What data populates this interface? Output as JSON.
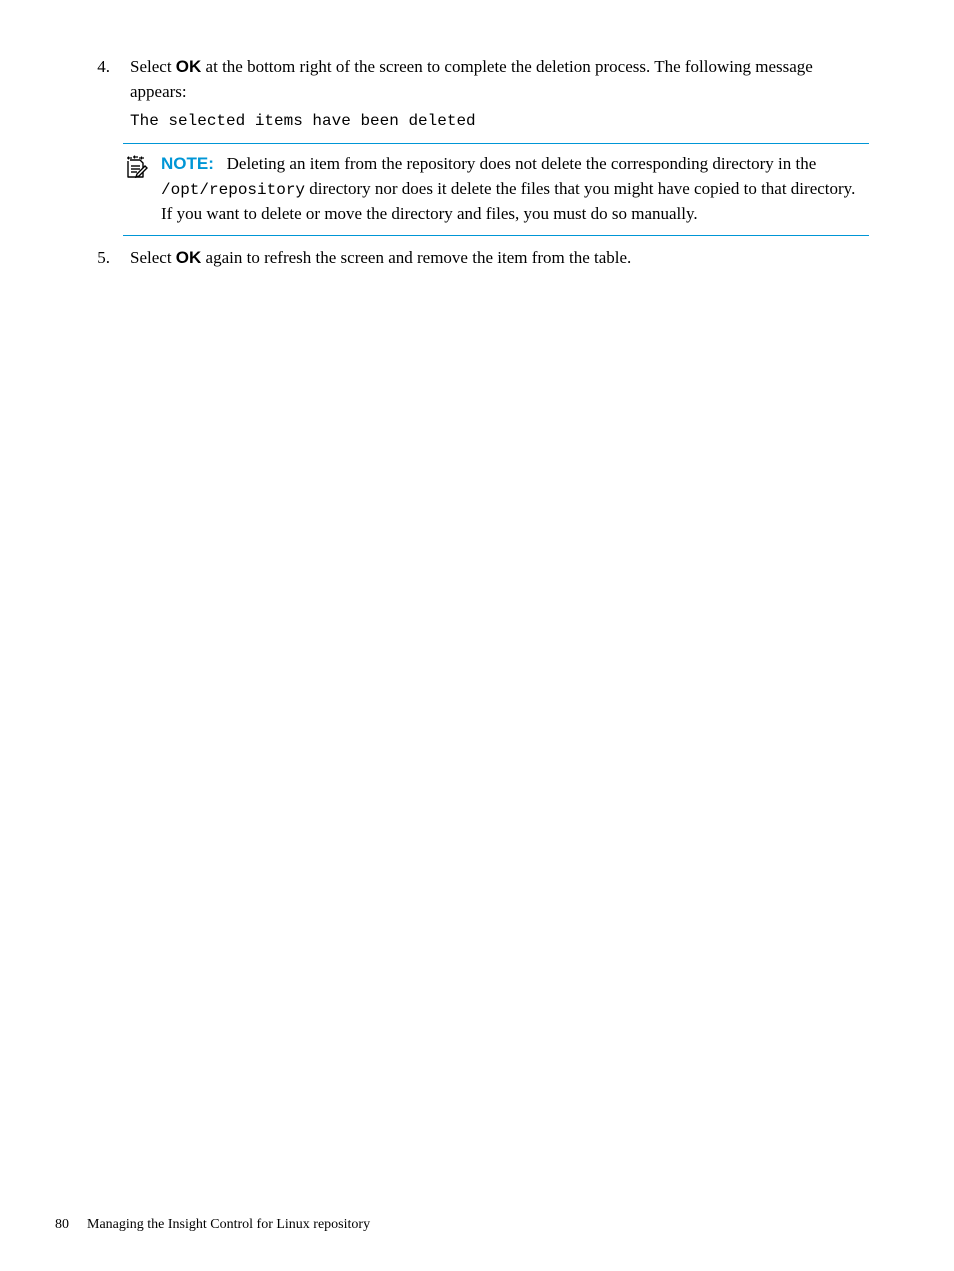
{
  "step4": {
    "number": "4.",
    "text_before_ok": "Select ",
    "ok": "OK",
    "text_after_ok": " at the bottom right of the screen to complete the deletion process. The following message appears:",
    "deleted_message": "The selected items have been deleted"
  },
  "note": {
    "label": "NOTE:",
    "text_before_path": "Deleting an item from the repository does not delete the corresponding directory in the ",
    "path": "/opt/repository",
    "text_after_path": " directory nor does it delete the files that you might have copied to that directory. If you want to delete or move the directory and files, you must do so manually."
  },
  "step5": {
    "number": "5.",
    "text_before_ok": "Select ",
    "ok": "OK",
    "text_after_ok": " again to refresh the screen and remove the item from the table."
  },
  "footer": {
    "page_number": "80",
    "title": "Managing the Insight Control for Linux repository"
  }
}
